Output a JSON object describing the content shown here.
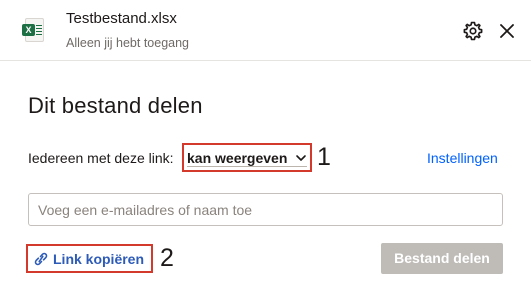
{
  "header": {
    "file_name": "Testbestand.xlsx",
    "access_text": "Alleen jij hebt toegang",
    "file_icon": "excel-file-icon",
    "file_icon_letter": "X",
    "settings_icon": "gear-icon",
    "close_icon": "close-icon"
  },
  "dialog": {
    "title": "Dit bestand delen",
    "link_label": "Iedereen met deze link:",
    "permission": "kan weergeven",
    "settings_link": "Instellingen",
    "email_placeholder": "Voeg een e-mailadres of naam toe",
    "copy_link_label": "Link kopiëren",
    "share_button": "Bestand delen",
    "annotations": [
      "1",
      "2"
    ]
  },
  "colors": {
    "accent": "#0061fe",
    "highlight_box": "#d33a2c",
    "disabled_button": "#bfbcb8",
    "excel_green": "#1d7044"
  }
}
